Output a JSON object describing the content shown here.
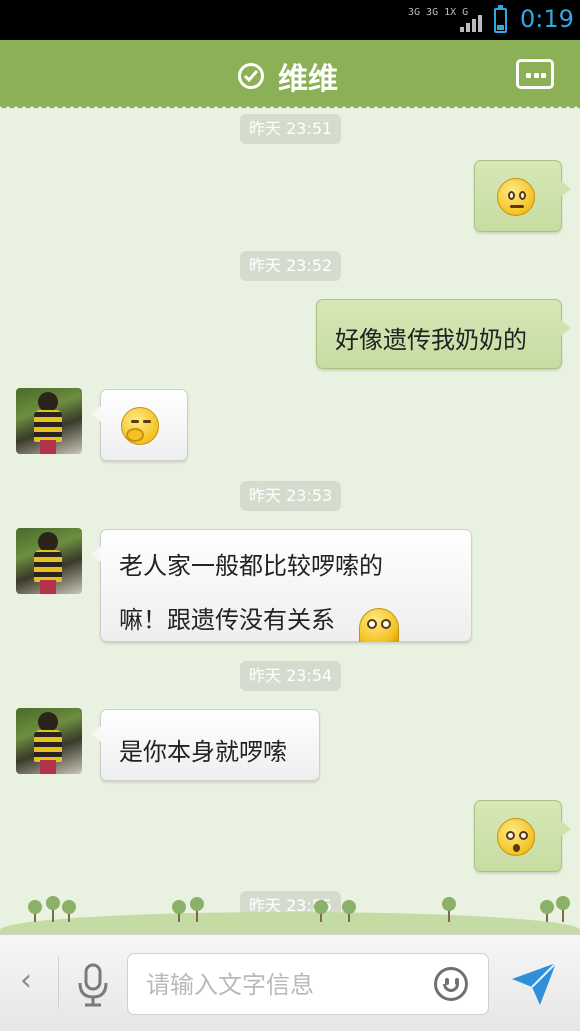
{
  "status_bar": {
    "network": "3G 3G 1X G",
    "time": "0:19"
  },
  "header": {
    "title": "维维",
    "status_icon": "check-circle-icon",
    "more_icon": "more-options-icon",
    "bg_color": "#8bb055"
  },
  "messages": [
    {
      "type": "timestamp",
      "text": "昨天 23:51"
    },
    {
      "type": "emoji",
      "side": "right",
      "icon": "confused-face-emoji"
    },
    {
      "type": "timestamp",
      "text": "昨天 23:52"
    },
    {
      "type": "text",
      "side": "right",
      "text": "好像遗传我奶奶的"
    },
    {
      "type": "emoji",
      "side": "left",
      "icon": "giggle-face-emoji"
    },
    {
      "type": "timestamp",
      "text": "昨天 23:53"
    },
    {
      "type": "text",
      "side": "left",
      "lines": [
        "老人家一般都比较啰嗦的",
        "嘛！跟遗传没有关系"
      ],
      "trailing_icon": "wide-eyed-face-emoji"
    },
    {
      "type": "timestamp",
      "text": "昨天 23:54"
    },
    {
      "type": "text",
      "side": "left",
      "text": "是你本身就啰嗦"
    },
    {
      "type": "emoji",
      "side": "right",
      "icon": "puzzled-face-emoji"
    },
    {
      "type": "timestamp",
      "text": "昨天 23:55"
    }
  ],
  "input_bar": {
    "back_icon": "chevron-left-icon",
    "mic_icon": "microphone-icon",
    "placeholder": "请输入文字信息",
    "emoji_icon": "smiley-icon",
    "send_icon": "send-icon"
  }
}
